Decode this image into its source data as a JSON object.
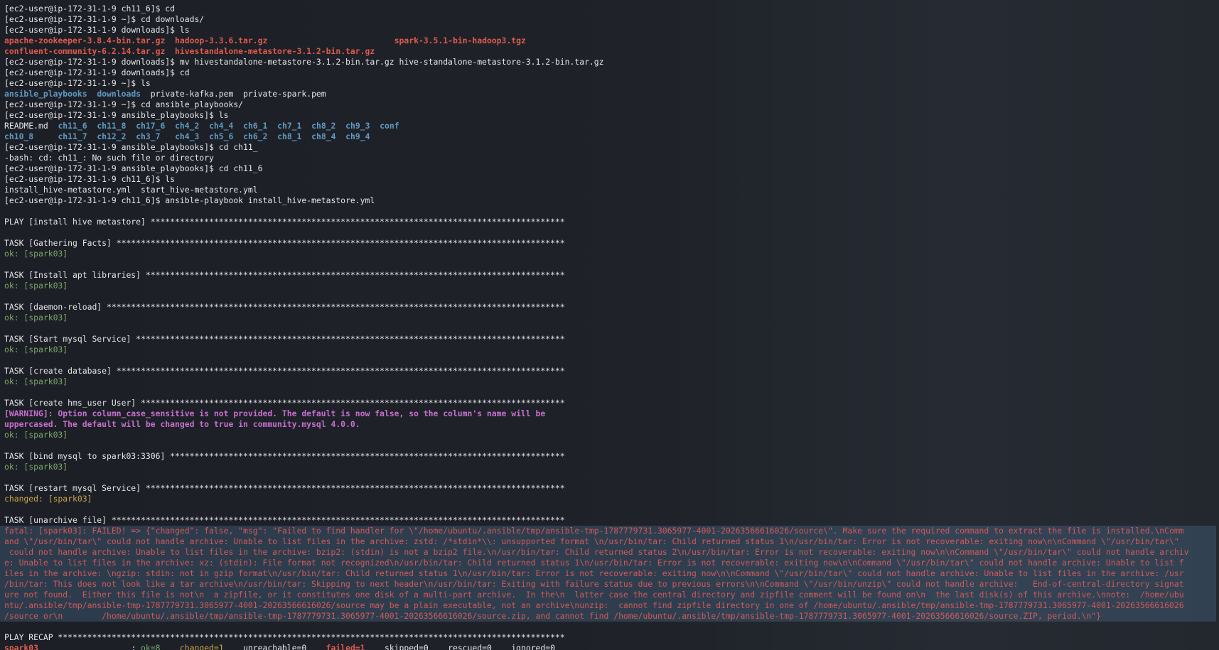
{
  "terminal": {
    "lines": [
      {
        "text": "[ec2-user@ip-172-31-1-9 ch11_6]$ cd"
      },
      {
        "text": "[ec2-user@ip-172-31-1-9 ~]$ cd downloads/"
      },
      {
        "text": "[ec2-user@ip-172-31-1-9 downloads]$ ls"
      },
      {
        "segments": [
          {
            "t": "apache-zookeeper-3.8.4-bin.tar.gz",
            "c": "red"
          },
          {
            "t": "  "
          },
          {
            "t": "hadoop-3.3.6.tar.gz",
            "c": "red"
          },
          {
            "t": "                          "
          },
          {
            "t": "spark-3.5.1-bin-hadoop3.tgz",
            "c": "red"
          }
        ]
      },
      {
        "segments": [
          {
            "t": "confluent-community-6.2.14.tar.gz",
            "c": "red"
          },
          {
            "t": "  "
          },
          {
            "t": "hivestandalone-metastore-3.1.2-bin.tar.gz",
            "c": "red"
          }
        ]
      },
      {
        "text": "[ec2-user@ip-172-31-1-9 downloads]$ mv hivestandalone-metastore-3.1.2-bin.tar.gz hive-standalone-metastore-3.1.2-bin.tar.gz"
      },
      {
        "text": "[ec2-user@ip-172-31-1-9 downloads]$ cd"
      },
      {
        "text": "[ec2-user@ip-172-31-1-9 ~]$ ls"
      },
      {
        "segments": [
          {
            "t": "ansible_playbooks",
            "c": "blue"
          },
          {
            "t": "  "
          },
          {
            "t": "downloads",
            "c": "blue"
          },
          {
            "t": "  private-kafka.pem  private-spark.pem"
          }
        ]
      },
      {
        "text": "[ec2-user@ip-172-31-1-9 ~]$ cd ansible_playbooks/"
      },
      {
        "text": "[ec2-user@ip-172-31-1-9 ansible_playbooks]$ ls"
      },
      {
        "segments": [
          {
            "t": "README.md  "
          },
          {
            "t": "ch11_6",
            "c": "blue"
          },
          {
            "t": "  "
          },
          {
            "t": "ch11_8",
            "c": "blue"
          },
          {
            "t": "  "
          },
          {
            "t": "ch17_6",
            "c": "blue"
          },
          {
            "t": "  "
          },
          {
            "t": "ch4_2",
            "c": "blue"
          },
          {
            "t": "  "
          },
          {
            "t": "ch4_4",
            "c": "blue"
          },
          {
            "t": "  "
          },
          {
            "t": "ch6_1",
            "c": "blue"
          },
          {
            "t": "  "
          },
          {
            "t": "ch7_1",
            "c": "blue"
          },
          {
            "t": "  "
          },
          {
            "t": "ch8_2",
            "c": "blue"
          },
          {
            "t": "  "
          },
          {
            "t": "ch9_3",
            "c": "blue"
          },
          {
            "t": "  "
          },
          {
            "t": "conf",
            "c": "blue"
          }
        ]
      },
      {
        "segments": [
          {
            "t": "ch10_8",
            "c": "blue"
          },
          {
            "t": "     "
          },
          {
            "t": "ch11_7",
            "c": "blue"
          },
          {
            "t": "  "
          },
          {
            "t": "ch12_2",
            "c": "blue"
          },
          {
            "t": "  "
          },
          {
            "t": "ch3_7",
            "c": "blue"
          },
          {
            "t": "   "
          },
          {
            "t": "ch4_3",
            "c": "blue"
          },
          {
            "t": "  "
          },
          {
            "t": "ch5_6",
            "c": "blue"
          },
          {
            "t": "  "
          },
          {
            "t": "ch6_2",
            "c": "blue"
          },
          {
            "t": "  "
          },
          {
            "t": "ch8_1",
            "c": "blue"
          },
          {
            "t": "  "
          },
          {
            "t": "ch8_4",
            "c": "blue"
          },
          {
            "t": "  "
          },
          {
            "t": "ch9_4",
            "c": "blue"
          }
        ]
      },
      {
        "text": "[ec2-user@ip-172-31-1-9 ansible_playbooks]$ cd ch11_"
      },
      {
        "text": "-bash: cd: ch11_: No such file or directory"
      },
      {
        "text": "[ec2-user@ip-172-31-1-9 ansible_playbooks]$ cd ch11_6"
      },
      {
        "text": "[ec2-user@ip-172-31-1-9 ch11_6]$ ls"
      },
      {
        "text": "install_hive-metastore.yml  start_hive-metastore.yml"
      },
      {
        "text": "[ec2-user@ip-172-31-1-9 ch11_6]$ ansible-playbook install_hive-metastore.yml"
      },
      {
        "text": ""
      },
      {
        "text": "PLAY [install hive metastore] *************************************************************************************"
      },
      {
        "text": ""
      },
      {
        "text": "TASK [Gathering Facts] ********************************************************************************************"
      },
      {
        "text": "ok: [spark03]",
        "c": "green"
      },
      {
        "text": ""
      },
      {
        "text": "TASK [Install apt libraries] **************************************************************************************"
      },
      {
        "text": "ok: [spark03]",
        "c": "green"
      },
      {
        "text": ""
      },
      {
        "text": "TASK [daemon-reload] **********************************************************************************************"
      },
      {
        "text": "ok: [spark03]",
        "c": "green"
      },
      {
        "text": ""
      },
      {
        "text": "TASK [Start mysql Service] ****************************************************************************************"
      },
      {
        "text": "ok: [spark03]",
        "c": "green"
      },
      {
        "text": ""
      },
      {
        "text": "TASK [create database] ********************************************************************************************"
      },
      {
        "text": "ok: [spark03]",
        "c": "green"
      },
      {
        "text": ""
      },
      {
        "text": "TASK [create hms_user User] ***************************************************************************************"
      },
      {
        "text": "[WARNING]: Option column_case_sensitive is not provided. The default is now false, so the column's name will be",
        "c": "magenta"
      },
      {
        "text": "uppercased. The default will be changed to true in community.mysql 4.0.0.",
        "c": "magenta"
      },
      {
        "text": "ok: [spark03]",
        "c": "green"
      },
      {
        "text": ""
      },
      {
        "text": "TASK [bind mysql to spark03:3306] *********************************************************************************"
      },
      {
        "text": "ok: [spark03]",
        "c": "green"
      },
      {
        "text": ""
      },
      {
        "text": "TASK [restart mysql Service] **************************************************************************************"
      },
      {
        "text": "changed: [spark03]",
        "c": "yellow"
      },
      {
        "text": ""
      },
      {
        "text": "TASK [unarchive file] *********************************************************************************************"
      }
    ],
    "fatal_lines": [
      "fatal: [spark03]: FAILED! => {\"changed\": false, \"msg\": \"Failed to find handler for \\\"/home/ubuntu/.ansible/tmp/ansible-tmp-1787779731.3065977-4001-20263566616026/source\\\". Make sure the required command to extract the file is installed.\\nComm",
      "and \\\"/usr/bin/tar\\\" could not handle archive: Unable to list files in the archive: zstd: /*stdin*\\\\: unsupported format \\n/usr/bin/tar: Child returned status 1\\n/usr/bin/tar: Error is not recoverable: exiting now\\n\\nCommand \\\"/usr/bin/tar\\\"",
      " could not handle archive: Unable to list files in the archive: bzip2: (stdin) is not a bzip2 file.\\n/usr/bin/tar: Child returned status 2\\n/usr/bin/tar: Error is not recoverable: exiting now\\n\\nCommand \\\"/usr/bin/tar\\\" could not handle archiv",
      "e: Unable to list files in the archive: xz: (stdin): File format not recognized\\n/usr/bin/tar: Child returned status 1\\n/usr/bin/tar: Error is not recoverable: exiting now\\n\\nCommand \\\"/usr/bin/tar\\\" could not handle archive: Unable to list f",
      "iles in the archive: \\ngzip: stdin: not in gzip format\\n/usr/bin/tar: Child returned status 1\\n/usr/bin/tar: Error is not recoverable: exiting now\\n\\nCommand \\\"/usr/bin/tar\\\" could not handle archive: Unable to list files in the archive: /usr",
      "/bin/tar: This does not look like a tar archive\\n/usr/bin/tar: Skipping to next header\\n/usr/bin/tar: Exiting with failure status due to previous errors\\n\\nCommand \\\"/usr/bin/unzip\\\" could not handle archive:   End-of-central-directory signat",
      "ure not found.  Either this file is not\\n  a zipfile, or it constitutes one disk of a multi-part archive.  In the\\n  latter case the central directory and zipfile comment will be found on\\n  the last disk(s) of this archive.\\nnote:  /home/ubu",
      "ntu/.ansible/tmp/ansible-tmp-1787779731.3065977-4001-20263566616026/source may be a plain executable, not an archive\\nunzip:  cannot find zipfile directory in one of /home/ubuntu/.ansible/tmp/ansible-tmp-1787779731.3065977-4001-20263566616026",
      "/source or\\n        /home/ubuntu/.ansible/tmp/ansible-tmp-1787779731.3065977-4001-20263566616026/source.zip, and cannot find /home/ubuntu/.ansible/tmp/ansible-tmp-1787779731.3065977-4001-20263566616026/source.ZIP, period.\\n\"}"
    ],
    "recap_lines": [
      {
        "text": ""
      },
      {
        "text": "PLAY RECAP ********************************************************************************************************"
      },
      {
        "segments": [
          {
            "t": "spark03",
            "c": "red"
          },
          {
            "t": "                   : "
          },
          {
            "t": "ok=8",
            "c": "green"
          },
          {
            "t": "    "
          },
          {
            "t": "changed=1",
            "c": "yellow"
          },
          {
            "t": "    unreachable=0    "
          },
          {
            "t": "failed=1",
            "c": "red"
          },
          {
            "t": "    skipped=0    rescued=0    ignored=0"
          }
        ]
      }
    ]
  },
  "colors": {
    "background": "#1d2026",
    "text": "#e4e6ea",
    "red": "#e05a4f",
    "blue": "#5f9ac4",
    "green": "#7da86c",
    "yellow": "#c9a54a",
    "magenta": "#c86fd1",
    "fatal": "#cf5a5a",
    "selection": "#3a5674"
  }
}
